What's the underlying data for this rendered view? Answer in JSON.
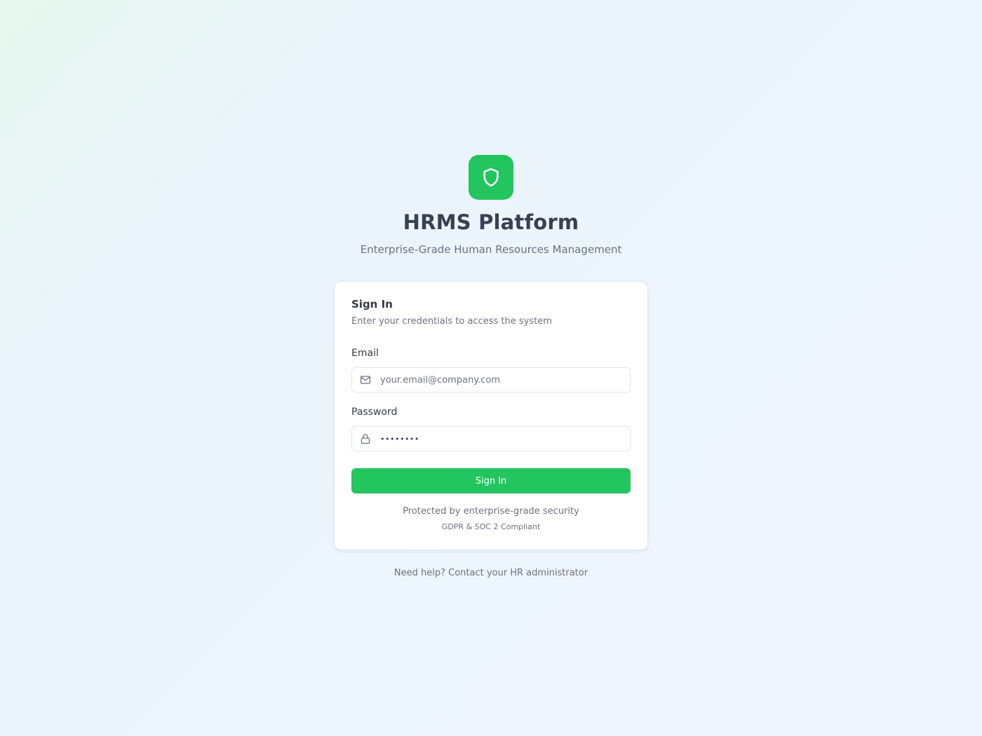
{
  "brand": {
    "title": "HRMS Platform",
    "subtitle": "Enterprise-Grade Human Resources Management",
    "icon": "shield-icon",
    "accent_color": "#22c55e"
  },
  "signin": {
    "title": "Sign In",
    "description": "Enter your credentials to access the system",
    "email": {
      "label": "Email",
      "placeholder": "your.email@company.com",
      "value": "",
      "icon": "mail-icon"
    },
    "password": {
      "label": "Password",
      "value": "••••••••",
      "icon": "lock-icon"
    },
    "button_label": "Sign In",
    "security_note": "Protected by enterprise-grade security",
    "compliance_note": "GDPR & SOC 2 Compliant"
  },
  "help": {
    "text": "Need help? Contact your HR administrator"
  }
}
